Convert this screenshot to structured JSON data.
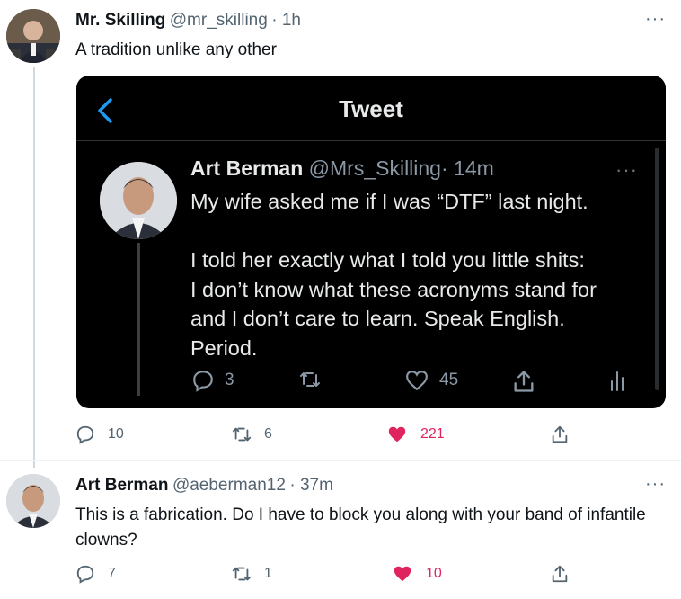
{
  "tweet1": {
    "name": "Mr. Skilling",
    "handle": "@mr_skilling",
    "time": "· 1h",
    "text": "A tradition unlike any other",
    "more": "···",
    "replies": "10",
    "retweets": "6",
    "likes": "221"
  },
  "embed": {
    "title": "Tweet",
    "name": "Art Berman",
    "handle": "@Mrs_Skilling",
    "time": "· 14m",
    "more": "···",
    "line1": "My wife asked me if I was “DTF” last night.",
    "line2": "I told her exactly what I told you little shits:",
    "line3": "I don’t know what these acronyms stand for",
    "line4": "and I don’t care to learn. Speak English.",
    "line5": "Period.",
    "replies": "3",
    "likes": "45"
  },
  "tweet2": {
    "name": "Art Berman",
    "handle": "@aeberman12",
    "time": "· 37m",
    "text_line1": "This is a fabrication. Do I have to block you along with your band of infantile",
    "text_line2": "clowns?",
    "more": "···",
    "replies": "7",
    "retweets": "1",
    "likes": "10"
  },
  "colors": {
    "like_active": "#e0245e",
    "icon_gray": "#536471"
  }
}
